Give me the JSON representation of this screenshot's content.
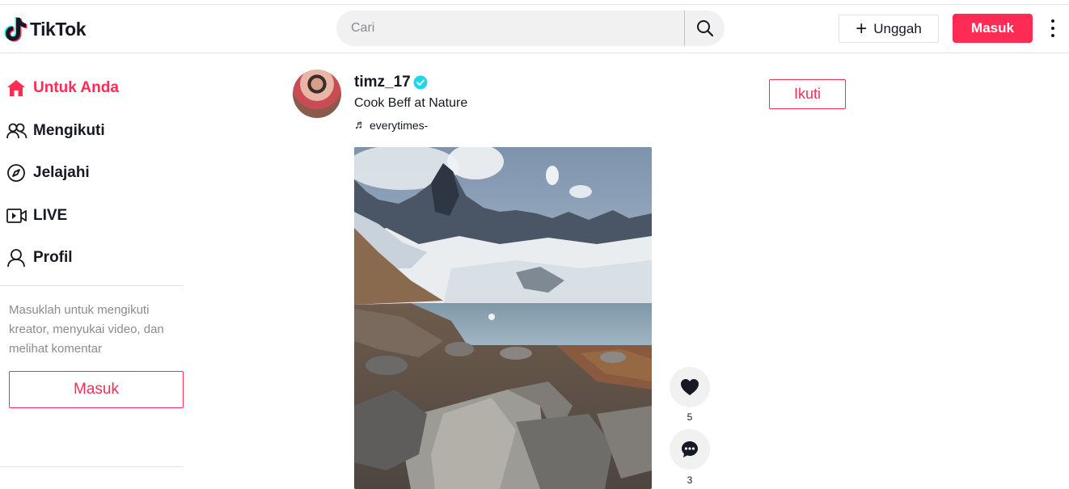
{
  "header": {
    "logo_text": "TikTok",
    "search_placeholder": "Cari",
    "upload_label": "Unggah",
    "login_label": "Masuk"
  },
  "sidebar": {
    "items": [
      {
        "label": "Untuk Anda",
        "icon": "home-icon",
        "active": true
      },
      {
        "label": "Mengikuti",
        "icon": "following-icon",
        "active": false
      },
      {
        "label": "Jelajahi",
        "icon": "compass-icon",
        "active": false
      },
      {
        "label": "LIVE",
        "icon": "live-icon",
        "active": false
      },
      {
        "label": "Profil",
        "icon": "profile-icon",
        "active": false
      }
    ],
    "login_prompt": "Masuklah untuk mengikuti kreator, menyukai video, dan melihat komentar",
    "login_button": "Masuk"
  },
  "post": {
    "username": "timz_17",
    "verified": true,
    "caption": "Cook Beff at Nature",
    "music": "everytimes-",
    "follow_label": "Ikuti",
    "likes": "5",
    "comments": "3"
  },
  "colors": {
    "accent": "#fe2c55",
    "text": "#161823",
    "muted": "#8a8b91",
    "verified": "#20d5ec"
  }
}
